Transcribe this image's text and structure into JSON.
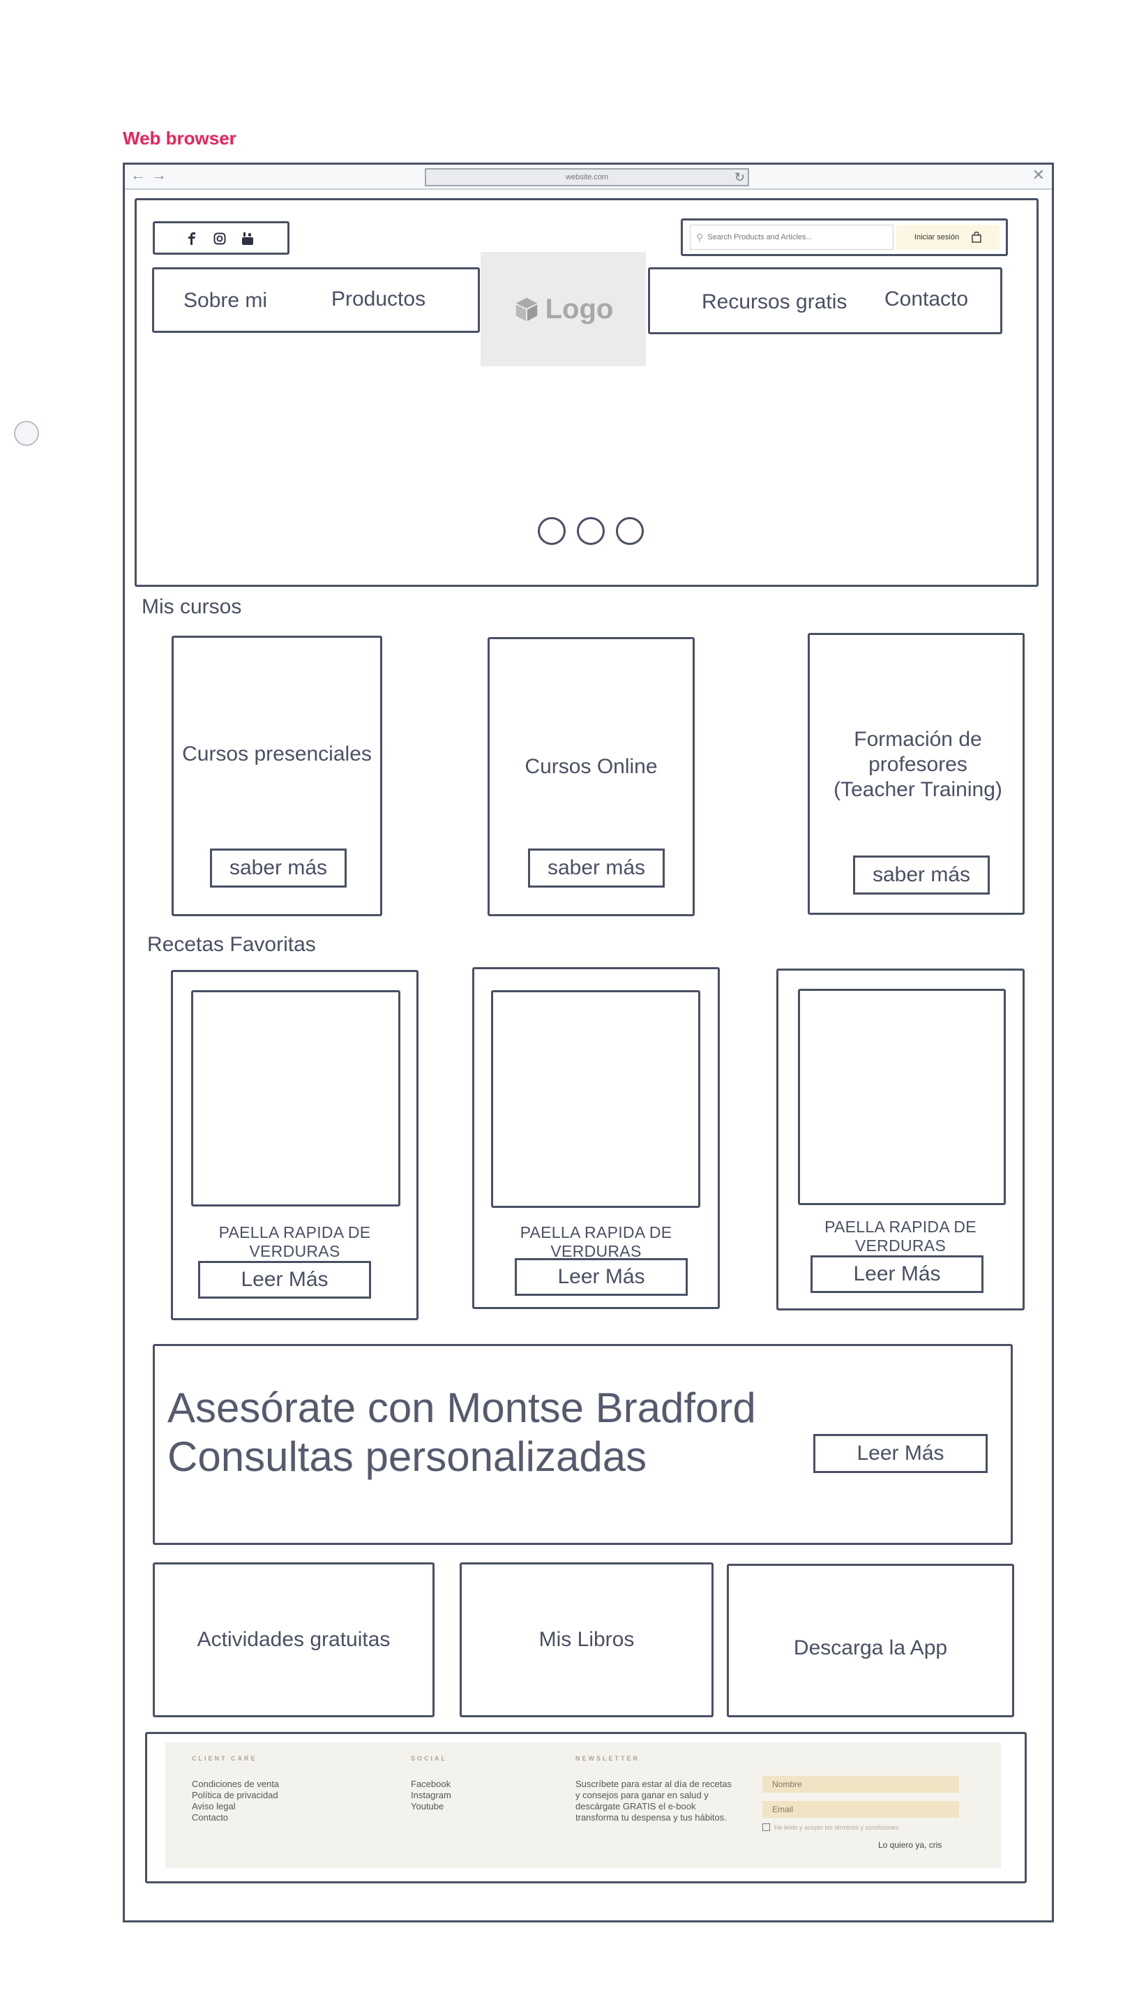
{
  "frame_title": "Web browser",
  "browser": {
    "url": "website.com",
    "back_icon": "arrow-left-icon",
    "forward_icon": "arrow-right-icon",
    "reload_icon": "reload-icon",
    "close_icon": "close-icon"
  },
  "header": {
    "social_icons": [
      "facebook-icon",
      "instagram-icon",
      "youtube-icon"
    ],
    "search_placeholder": "Search Products and Articles...",
    "login_label": "Iniciar sesión",
    "nav_left": [
      "Sobre mi",
      "Productos"
    ],
    "logo_text": "Logo",
    "nav_right": [
      "Recursos gratis",
      "Contacto"
    ]
  },
  "courses": {
    "title": "Mis cursos",
    "items": [
      {
        "title": "Cursos presenciales",
        "button": "saber más"
      },
      {
        "title": "Cursos Online",
        "button": "saber más"
      },
      {
        "title": "Formación de profesores (Teacher Training)",
        "button": "saber más"
      }
    ]
  },
  "recipes": {
    "title": "Recetas Favoritas",
    "items": [
      {
        "title": "PAELLA RAPIDA DE VERDURAS",
        "button": "Leer Más"
      },
      {
        "title": "PAELLA RAPIDA DE VERDURAS",
        "button": "Leer Más"
      },
      {
        "title": "PAELLA RAPIDA DE VERDURAS",
        "button": "Leer Más"
      }
    ]
  },
  "promo": {
    "line1": "Asesórate con Montse Bradford",
    "line2": "Consultas personalizadas",
    "button": "Leer Más"
  },
  "tiles": [
    "Actividades gratuitas",
    "Mis Libros",
    "Descarga la App"
  ],
  "footer": {
    "client_care_title": "CLIENT CARE",
    "client_care_links": [
      "Condiciones de venta",
      "Política de privacidad",
      "Aviso legal",
      "Contacto"
    ],
    "social_title": "SOCIAL",
    "social_links": [
      "Facebook",
      "Instagram",
      "Youtube"
    ],
    "newsletter_title": "NEWSLETTER",
    "newsletter_text": "Suscríbete para estar al día de recetas y consejos para ganar en salud y descárgate GRATIS el e-book transforma tu despensa y tus hábitos.",
    "name_placeholder": "Nombre",
    "email_placeholder": "Email",
    "terms_label": "He leído y acepto los términos y condiciones",
    "submit_label": "Lo quiero ya, cris"
  },
  "colors": {
    "accent": "#e8245a",
    "stroke": "#4a5064",
    "footer_bg": "#f4f2ec",
    "field_bg": "#f0e4c4",
    "login_bg": "#fbf7e3"
  }
}
